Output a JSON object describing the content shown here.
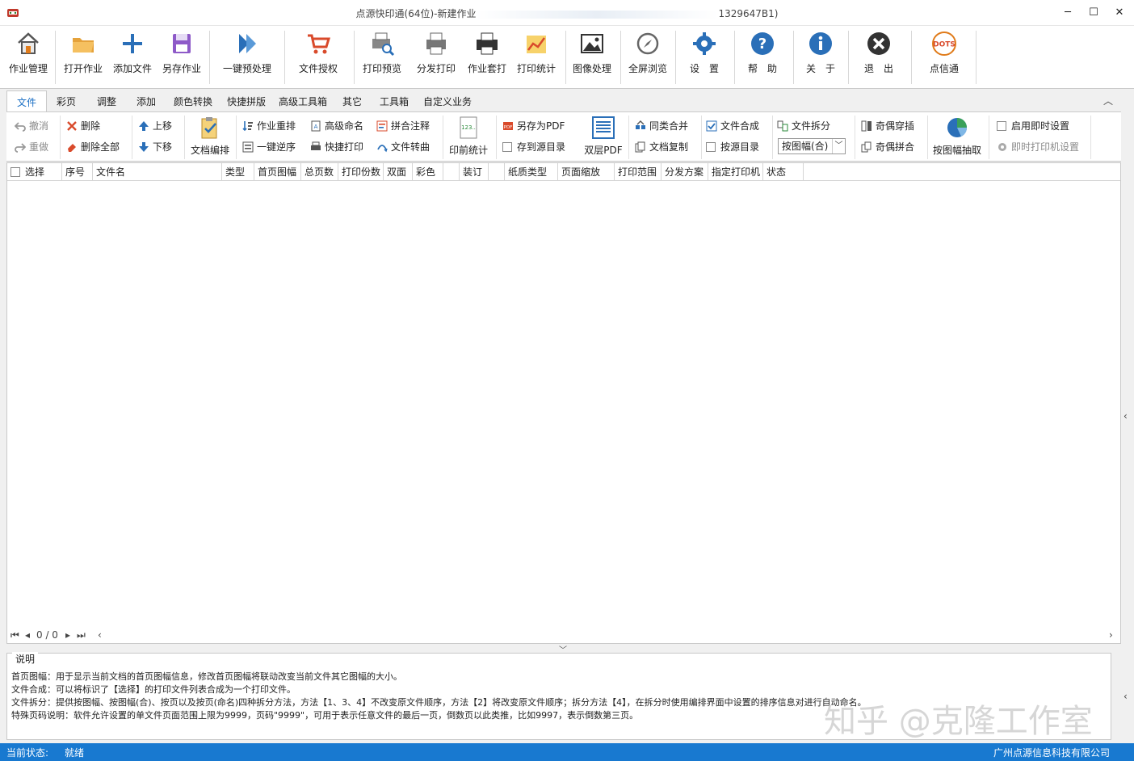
{
  "window": {
    "title": "点源快印通(64位)-新建作业",
    "title_suffix": "1329647B1)",
    "minimize": "─",
    "maximize": "☐",
    "close": "✕"
  },
  "toolbar": {
    "items": [
      {
        "label": "作业管理",
        "icon": "house-icon"
      },
      {
        "label": "打开作业",
        "icon": "folder-icon"
      },
      {
        "label": "添加文件",
        "icon": "plus-icon"
      },
      {
        "label": "另存作业",
        "icon": "save-icon"
      },
      {
        "label": "一键预处理",
        "icon": "arrows-icon"
      },
      {
        "label": "文件授权",
        "icon": "cart-icon"
      },
      {
        "label": "打印预览",
        "icon": "print-preview-icon"
      },
      {
        "label": "分发打印",
        "icon": "printer-icon"
      },
      {
        "label": "作业套打",
        "icon": "printer-dark-icon"
      },
      {
        "label": "打印统计",
        "icon": "chart-icon"
      },
      {
        "label": "图像处理",
        "icon": "image-icon"
      },
      {
        "label": "全屏浏览",
        "icon": "compass-icon"
      },
      {
        "label": "设　置",
        "icon": "gear-icon"
      },
      {
        "label": "帮　助",
        "icon": "help-icon"
      },
      {
        "label": "关　于",
        "icon": "info-icon"
      },
      {
        "label": "退　出",
        "icon": "exit-icon"
      },
      {
        "label": "点信通",
        "icon": "dots-icon",
        "badge": "DOTS"
      }
    ]
  },
  "tabs": [
    "文件",
    "彩页",
    "调整",
    "添加",
    "颜色转换",
    "快捷拼版",
    "高级工具箱",
    "其它",
    "工具箱",
    "自定义业务"
  ],
  "ribbon": {
    "undo": "撤消",
    "redo": "重做",
    "delete": "删除",
    "delete_all": "删除全部",
    "move_up": "上移",
    "move_down": "下移",
    "doc_arrange": "文档编排",
    "job_reorder": "作业重排",
    "one_key_reverse": "一键逆序",
    "advanced_naming": "高级命名",
    "quick_print": "快捷打印",
    "combine_annot": "拼合注释",
    "file_convert": "文件转曲",
    "prepress_stats": "印前统计",
    "save_as_pdf": "另存为PDF",
    "save_to_source": "存到源目录",
    "double_pdf": "双层PDF",
    "merge_same": "同类合并",
    "doc_copy": "文档复制",
    "file_compose": "文件合成",
    "by_source_dir": "按源目录",
    "file_split": "文件拆分",
    "split_mode": "按图幅(合)",
    "odd_even_insert": "奇偶穿插",
    "odd_even_combine": "奇偶拼合",
    "extract_by_size": "按图幅抽取",
    "enable_instant": "启用即时设置",
    "instant_printer": "即时打印机设置"
  },
  "grid": {
    "columns": [
      "选择",
      "序号",
      "文件名",
      "类型",
      "首页图幅",
      "总页数",
      "打印份数",
      "双面",
      "彩色",
      "",
      "装订",
      "",
      "纸质类型",
      "页面缩放",
      "打印范围",
      "分发方案",
      "指定打印机",
      "状态"
    ],
    "rows": [],
    "pager": {
      "first": "⏮",
      "prev": "◂",
      "page": "0 / 0",
      "next": "▸",
      "last": "⏭"
    }
  },
  "notes": {
    "legend": "说明",
    "lines": [
      "首页图幅：用于显示当前文档的首页图幅信息，修改首页图幅将联动改变当前文件其它图幅的大小。",
      "文件合成：可以将标识了【选择】的打印文件列表合成为一个打印文件。",
      "文件拆分：提供按图幅、按图幅(合)、按页以及按页(命名)四种拆分方法，方法【1、3、4】不改变原文件顺序，方法【2】将改变原文件顺序；拆分方法【4】，在拆分时使用编排界面中设置的排序信息对进行自动命名。",
      "特殊页码说明：软件允许设置的单文件页面范围上限为9999，页码\"9999\"，可用于表示任意文件的最后一页，倒数页以此类推，比如9997，表示倒数第三页。"
    ]
  },
  "watermark": "知乎 @克隆工作室",
  "status": {
    "label": "当前状态:",
    "value": "就绪",
    "company": "广州点源信息科技有限公司"
  },
  "colors": {
    "accent": "#1879d0",
    "tab_active": "#1a6fc4",
    "status_bar": "#1879d0"
  }
}
